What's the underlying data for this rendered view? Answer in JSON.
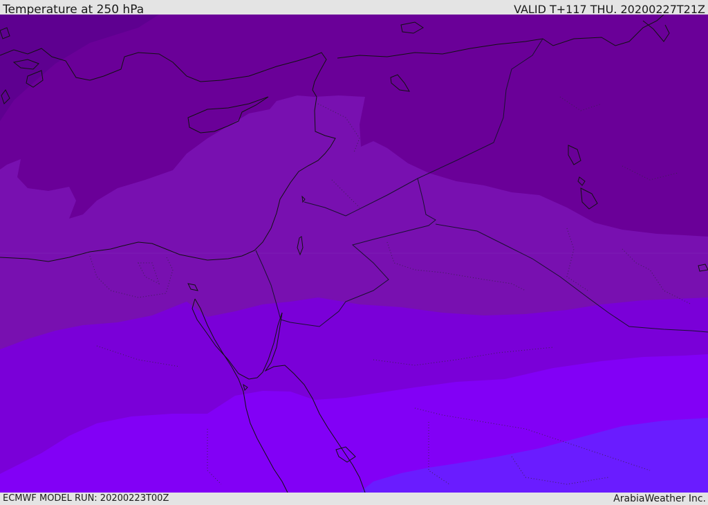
{
  "header": {
    "title": "Temperature at 250 hPa",
    "valid": "VALID T+117 THU. 20200227T21Z"
  },
  "footer": {
    "model_run": "ECMWF MODEL RUN: 20200223T00Z",
    "credit": "ArabiaWeather Inc."
  },
  "colors": {
    "band_coldest": "#5e0090",
    "band_1": "#6a0098",
    "band_2": "#7810b0",
    "band_3": "#7a00d8",
    "band_4": "#8200f6",
    "band_warmest": "#6a1cff",
    "coastline": "#111111",
    "border_dotted": "#3a2050"
  }
}
